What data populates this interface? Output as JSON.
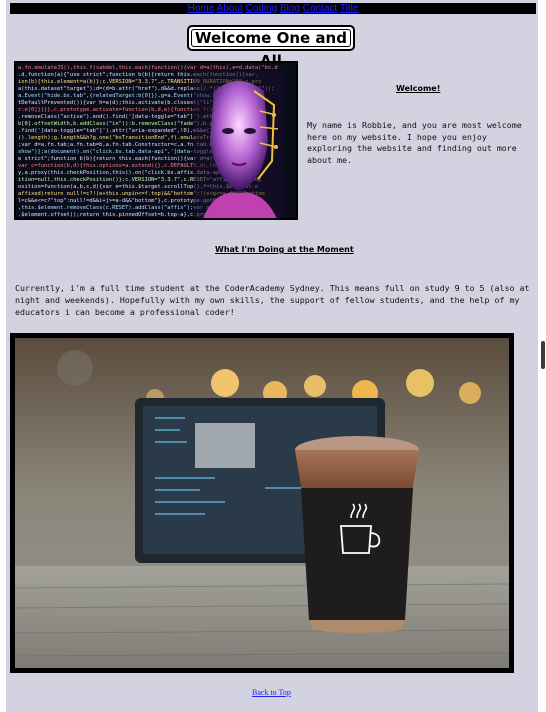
{
  "nav": {
    "items": [
      "Home",
      "About",
      "Coding",
      "Blog",
      "Contact",
      "Title"
    ]
  },
  "header": {
    "title": "Welcome One and All"
  },
  "intro": {
    "heading": "Welcome!",
    "text": "My name is Robbie, and you are most welcome here on my website. I hope you enjoy exploring the website and finding out more about me."
  },
  "doing": {
    "heading": "What I'm Doing at the Moment",
    "text": "Currently, i'm a full time student at the CoderAcademy Sydney. This means full on study 9 to 5 (also at night and weekends). Hopefully with my own skills, the support of fellow students, and the help of my educators i can become a professional coder!"
  },
  "footer": {
    "back_to_top": "Back to Top"
  },
  "colors": {
    "page_bg": "#d3d2e0",
    "nav_bg": "#000000",
    "link": "#2020ff"
  },
  "icons": {
    "hero_image": "code-face-image",
    "photo": "coffee-laptop-photo"
  }
}
